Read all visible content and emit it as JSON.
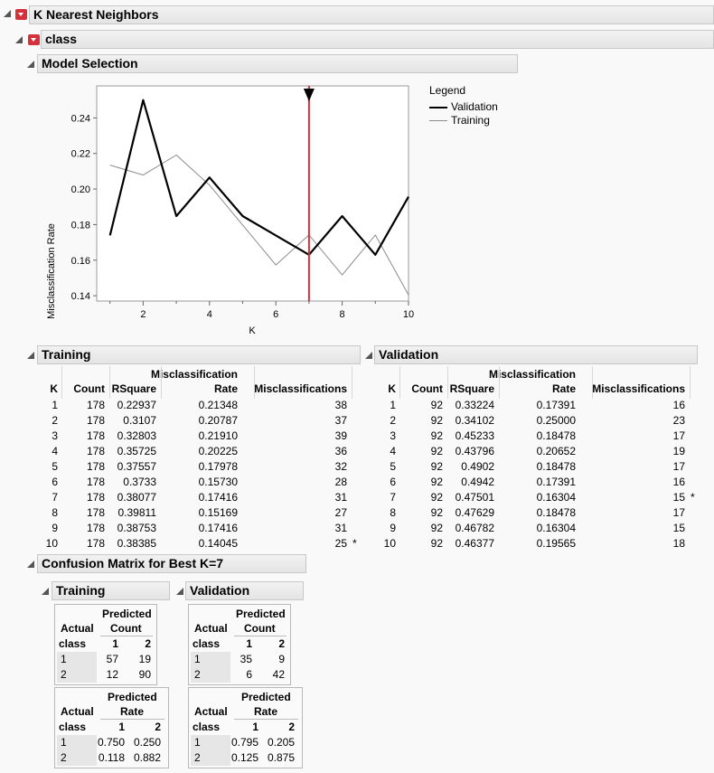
{
  "top": {
    "title": "K Nearest Neighbors"
  },
  "class_section": {
    "title": "class"
  },
  "model_selection": {
    "title": "Model Selection",
    "legend": {
      "title": "Legend",
      "validation": "Validation",
      "training": "Training"
    }
  },
  "chart_data": {
    "type": "line",
    "xlabel": "K",
    "ylabel": "Misclassification Rate",
    "xlim": [
      0.6,
      10.0
    ],
    "ylim": [
      0.137,
      0.258
    ],
    "x_ticks": [
      "2",
      "4",
      "6",
      "8",
      "10"
    ],
    "y_ticks": [
      "0.14",
      "0.16",
      "0.18",
      "0.20",
      "0.22",
      "0.24"
    ],
    "best_k": 7,
    "series": [
      {
        "name": "Validation",
        "color": "#000000",
        "x": [
          1,
          2,
          3,
          4,
          5,
          6,
          7,
          8,
          9,
          10
        ],
        "values": [
          0.17391,
          0.25,
          0.18478,
          0.20652,
          0.18478,
          0.17391,
          0.16304,
          0.18478,
          0.16304,
          0.19565
        ]
      },
      {
        "name": "Training",
        "color": "#8c8c8c",
        "x": [
          1,
          2,
          3,
          4,
          5,
          6,
          7,
          8,
          9,
          10
        ],
        "values": [
          0.21348,
          0.20787,
          0.2191,
          0.20225,
          0.17978,
          0.1573,
          0.17416,
          0.15169,
          0.17416,
          0.14045
        ]
      }
    ],
    "marker_color": "#d0313a"
  },
  "training": {
    "title": "Training",
    "headers": [
      "K",
      "Count",
      "RSquare",
      "Misclassification",
      "Rate",
      "Misclassifications"
    ],
    "rows": [
      [
        "1",
        "178",
        "0.22937",
        "0.21348",
        "38",
        ""
      ],
      [
        "2",
        "178",
        "0.3107",
        "0.20787",
        "37",
        ""
      ],
      [
        "3",
        "178",
        "0.32803",
        "0.21910",
        "39",
        ""
      ],
      [
        "4",
        "178",
        "0.35725",
        "0.20225",
        "36",
        ""
      ],
      [
        "5",
        "178",
        "0.37557",
        "0.17978",
        "32",
        ""
      ],
      [
        "6",
        "178",
        "0.3733",
        "0.15730",
        "28",
        ""
      ],
      [
        "7",
        "178",
        "0.38077",
        "0.17416",
        "31",
        ""
      ],
      [
        "8",
        "178",
        "0.39811",
        "0.15169",
        "27",
        ""
      ],
      [
        "9",
        "178",
        "0.38753",
        "0.17416",
        "31",
        ""
      ],
      [
        "10",
        "178",
        "0.38385",
        "0.14045",
        "25",
        "*"
      ]
    ]
  },
  "validation": {
    "title": "Validation",
    "headers": [
      "K",
      "Count",
      "RSquare",
      "Misclassification",
      "Rate",
      "Misclassifications"
    ],
    "rows": [
      [
        "1",
        "92",
        "0.33224",
        "0.17391",
        "16",
        ""
      ],
      [
        "2",
        "92",
        "0.34102",
        "0.25000",
        "23",
        ""
      ],
      [
        "3",
        "92",
        "0.45233",
        "0.18478",
        "17",
        ""
      ],
      [
        "4",
        "92",
        "0.43796",
        "0.20652",
        "19",
        ""
      ],
      [
        "5",
        "92",
        "0.4902",
        "0.18478",
        "17",
        ""
      ],
      [
        "6",
        "92",
        "0.4942",
        "0.17391",
        "16",
        ""
      ],
      [
        "7",
        "92",
        "0.47501",
        "0.16304",
        "15",
        "*"
      ],
      [
        "8",
        "92",
        "0.47629",
        "0.18478",
        "17",
        ""
      ],
      [
        "9",
        "92",
        "0.46782",
        "0.16304",
        "15",
        ""
      ],
      [
        "10",
        "92",
        "0.46377",
        "0.19565",
        "18",
        ""
      ]
    ]
  },
  "confusion": {
    "title": "Confusion Matrix for Best K=7",
    "labels": {
      "predicted": "Predicted",
      "count": "Count",
      "rate": "Rate",
      "actual": "Actual",
      "class": "class",
      "c1": "1",
      "c2": "2"
    },
    "training": {
      "title": "Training",
      "count": [
        [
          "57",
          "19"
        ],
        [
          "12",
          "90"
        ]
      ],
      "rate": [
        [
          "0.750",
          "0.250"
        ],
        [
          "0.118",
          "0.882"
        ]
      ]
    },
    "validation": {
      "title": "Validation",
      "count": [
        [
          "35",
          "9"
        ],
        [
          "6",
          "42"
        ]
      ],
      "rate": [
        [
          "0.795",
          "0.205"
        ],
        [
          "0.125",
          "0.875"
        ]
      ]
    }
  }
}
